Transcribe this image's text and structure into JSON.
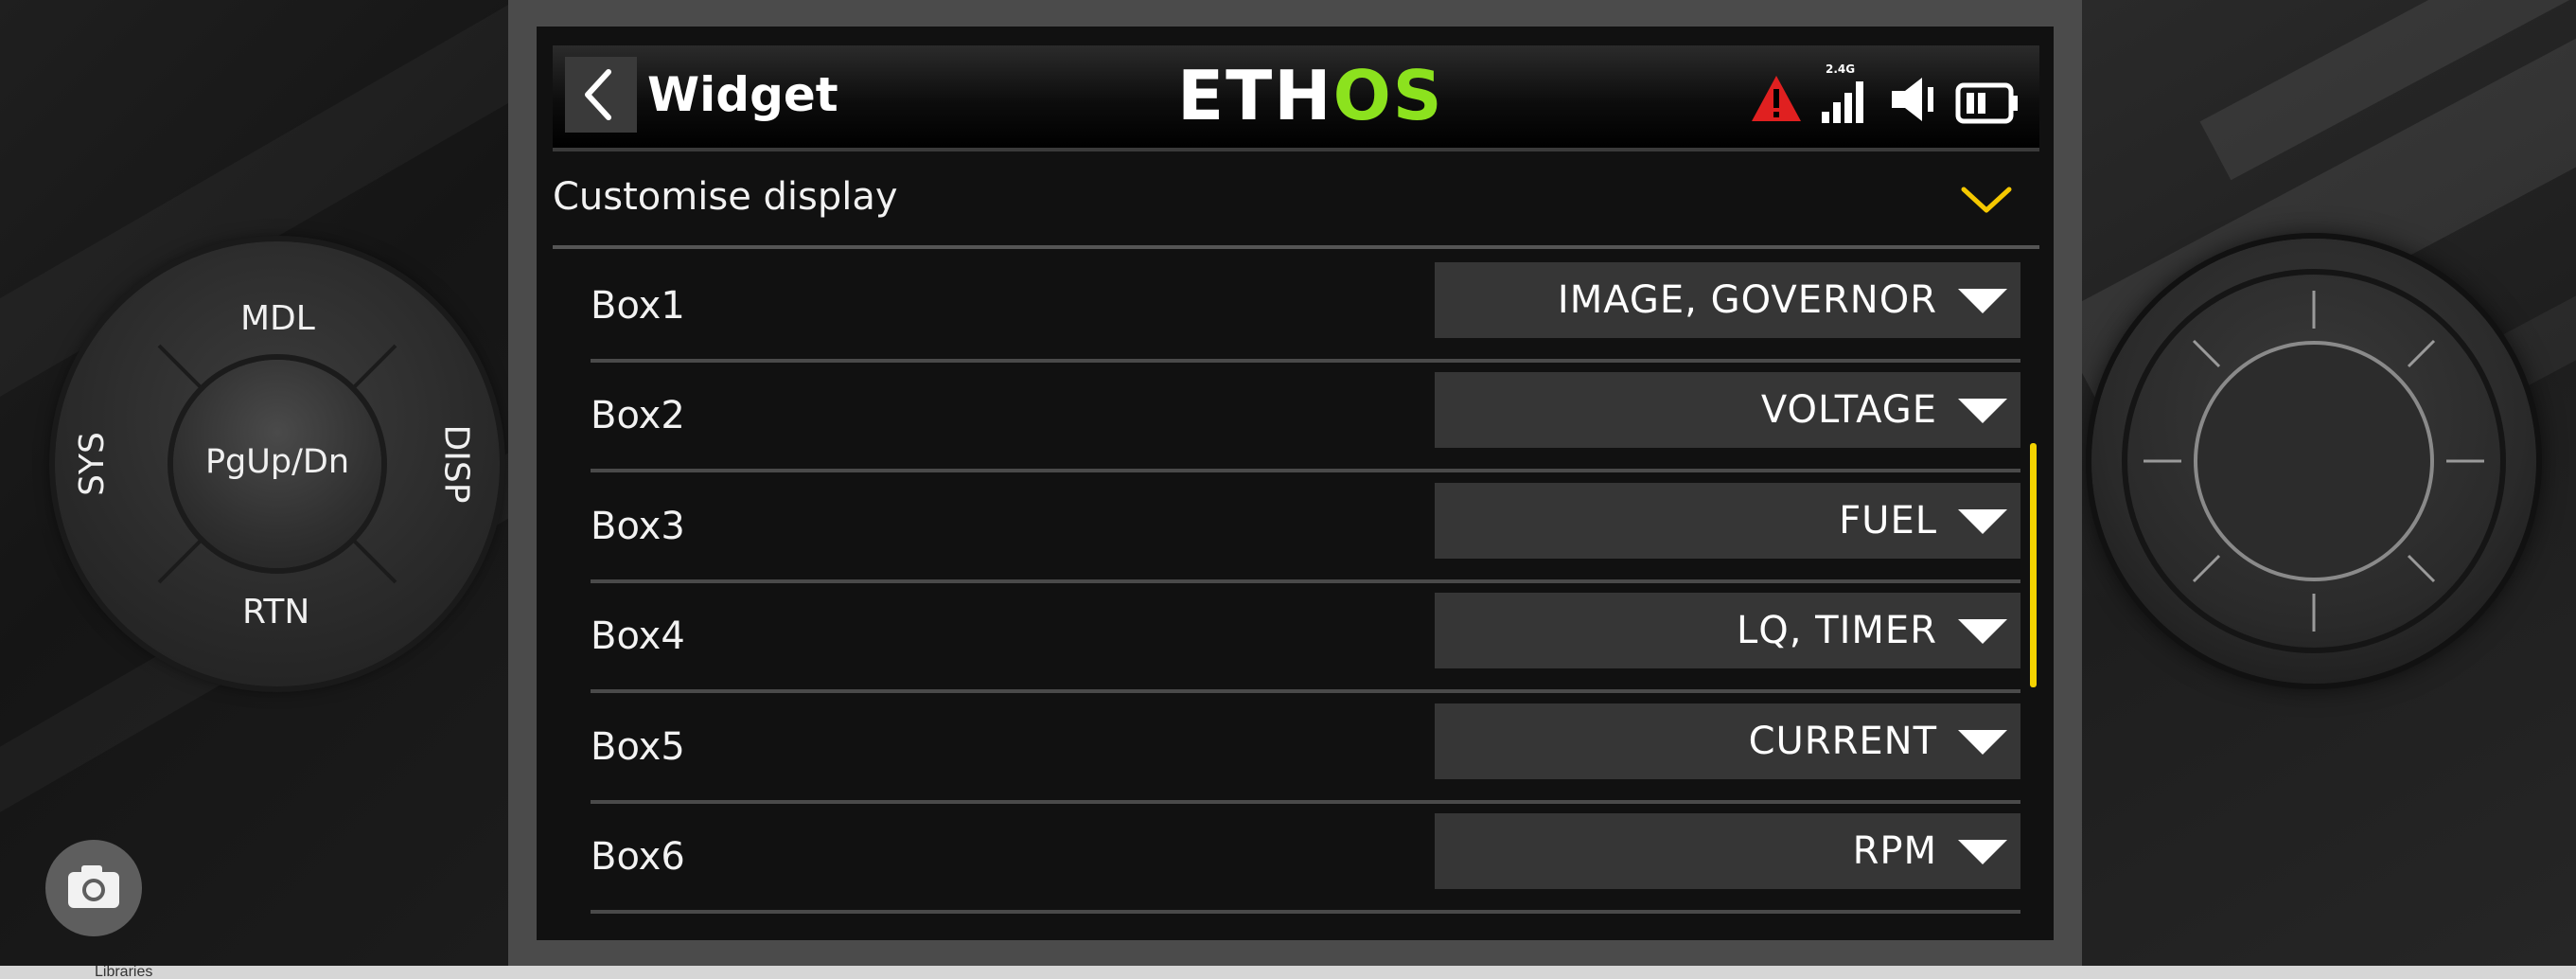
{
  "header": {
    "back_icon": "chevron-left-icon",
    "title": "Widget",
    "logo_part1": "ETH",
    "logo_part2": "OS",
    "status": {
      "warning_icon": "warning-triangle-icon",
      "signal_band": "2.4G",
      "signal_icon": "signal-bars-icon",
      "speaker_icon": "speaker-icon",
      "battery_icon": "battery-icon"
    }
  },
  "section": {
    "label": "Customise display",
    "toggle_icon": "chevron-down-icon"
  },
  "rows": [
    {
      "label": "Box1",
      "value": "IMAGE, GOVERNOR"
    },
    {
      "label": "Box2",
      "value": "VOLTAGE"
    },
    {
      "label": "Box3",
      "value": "FUEL"
    },
    {
      "label": "Box4",
      "value": "LQ, TIMER"
    },
    {
      "label": "Box5",
      "value": "CURRENT"
    },
    {
      "label": "Box6",
      "value": "RPM"
    }
  ],
  "dpad": {
    "top": "MDL",
    "left": "SYS",
    "right": "DISP",
    "bottom": "RTN",
    "center": "PgUp/Dn"
  },
  "taskbar": {
    "text": "Libraries"
  },
  "colors": {
    "accent_green": "#8ce21e",
    "scroll_yellow": "#f5d300",
    "warning_red": "#e02020",
    "chevron_yellow": "#f5c800"
  }
}
